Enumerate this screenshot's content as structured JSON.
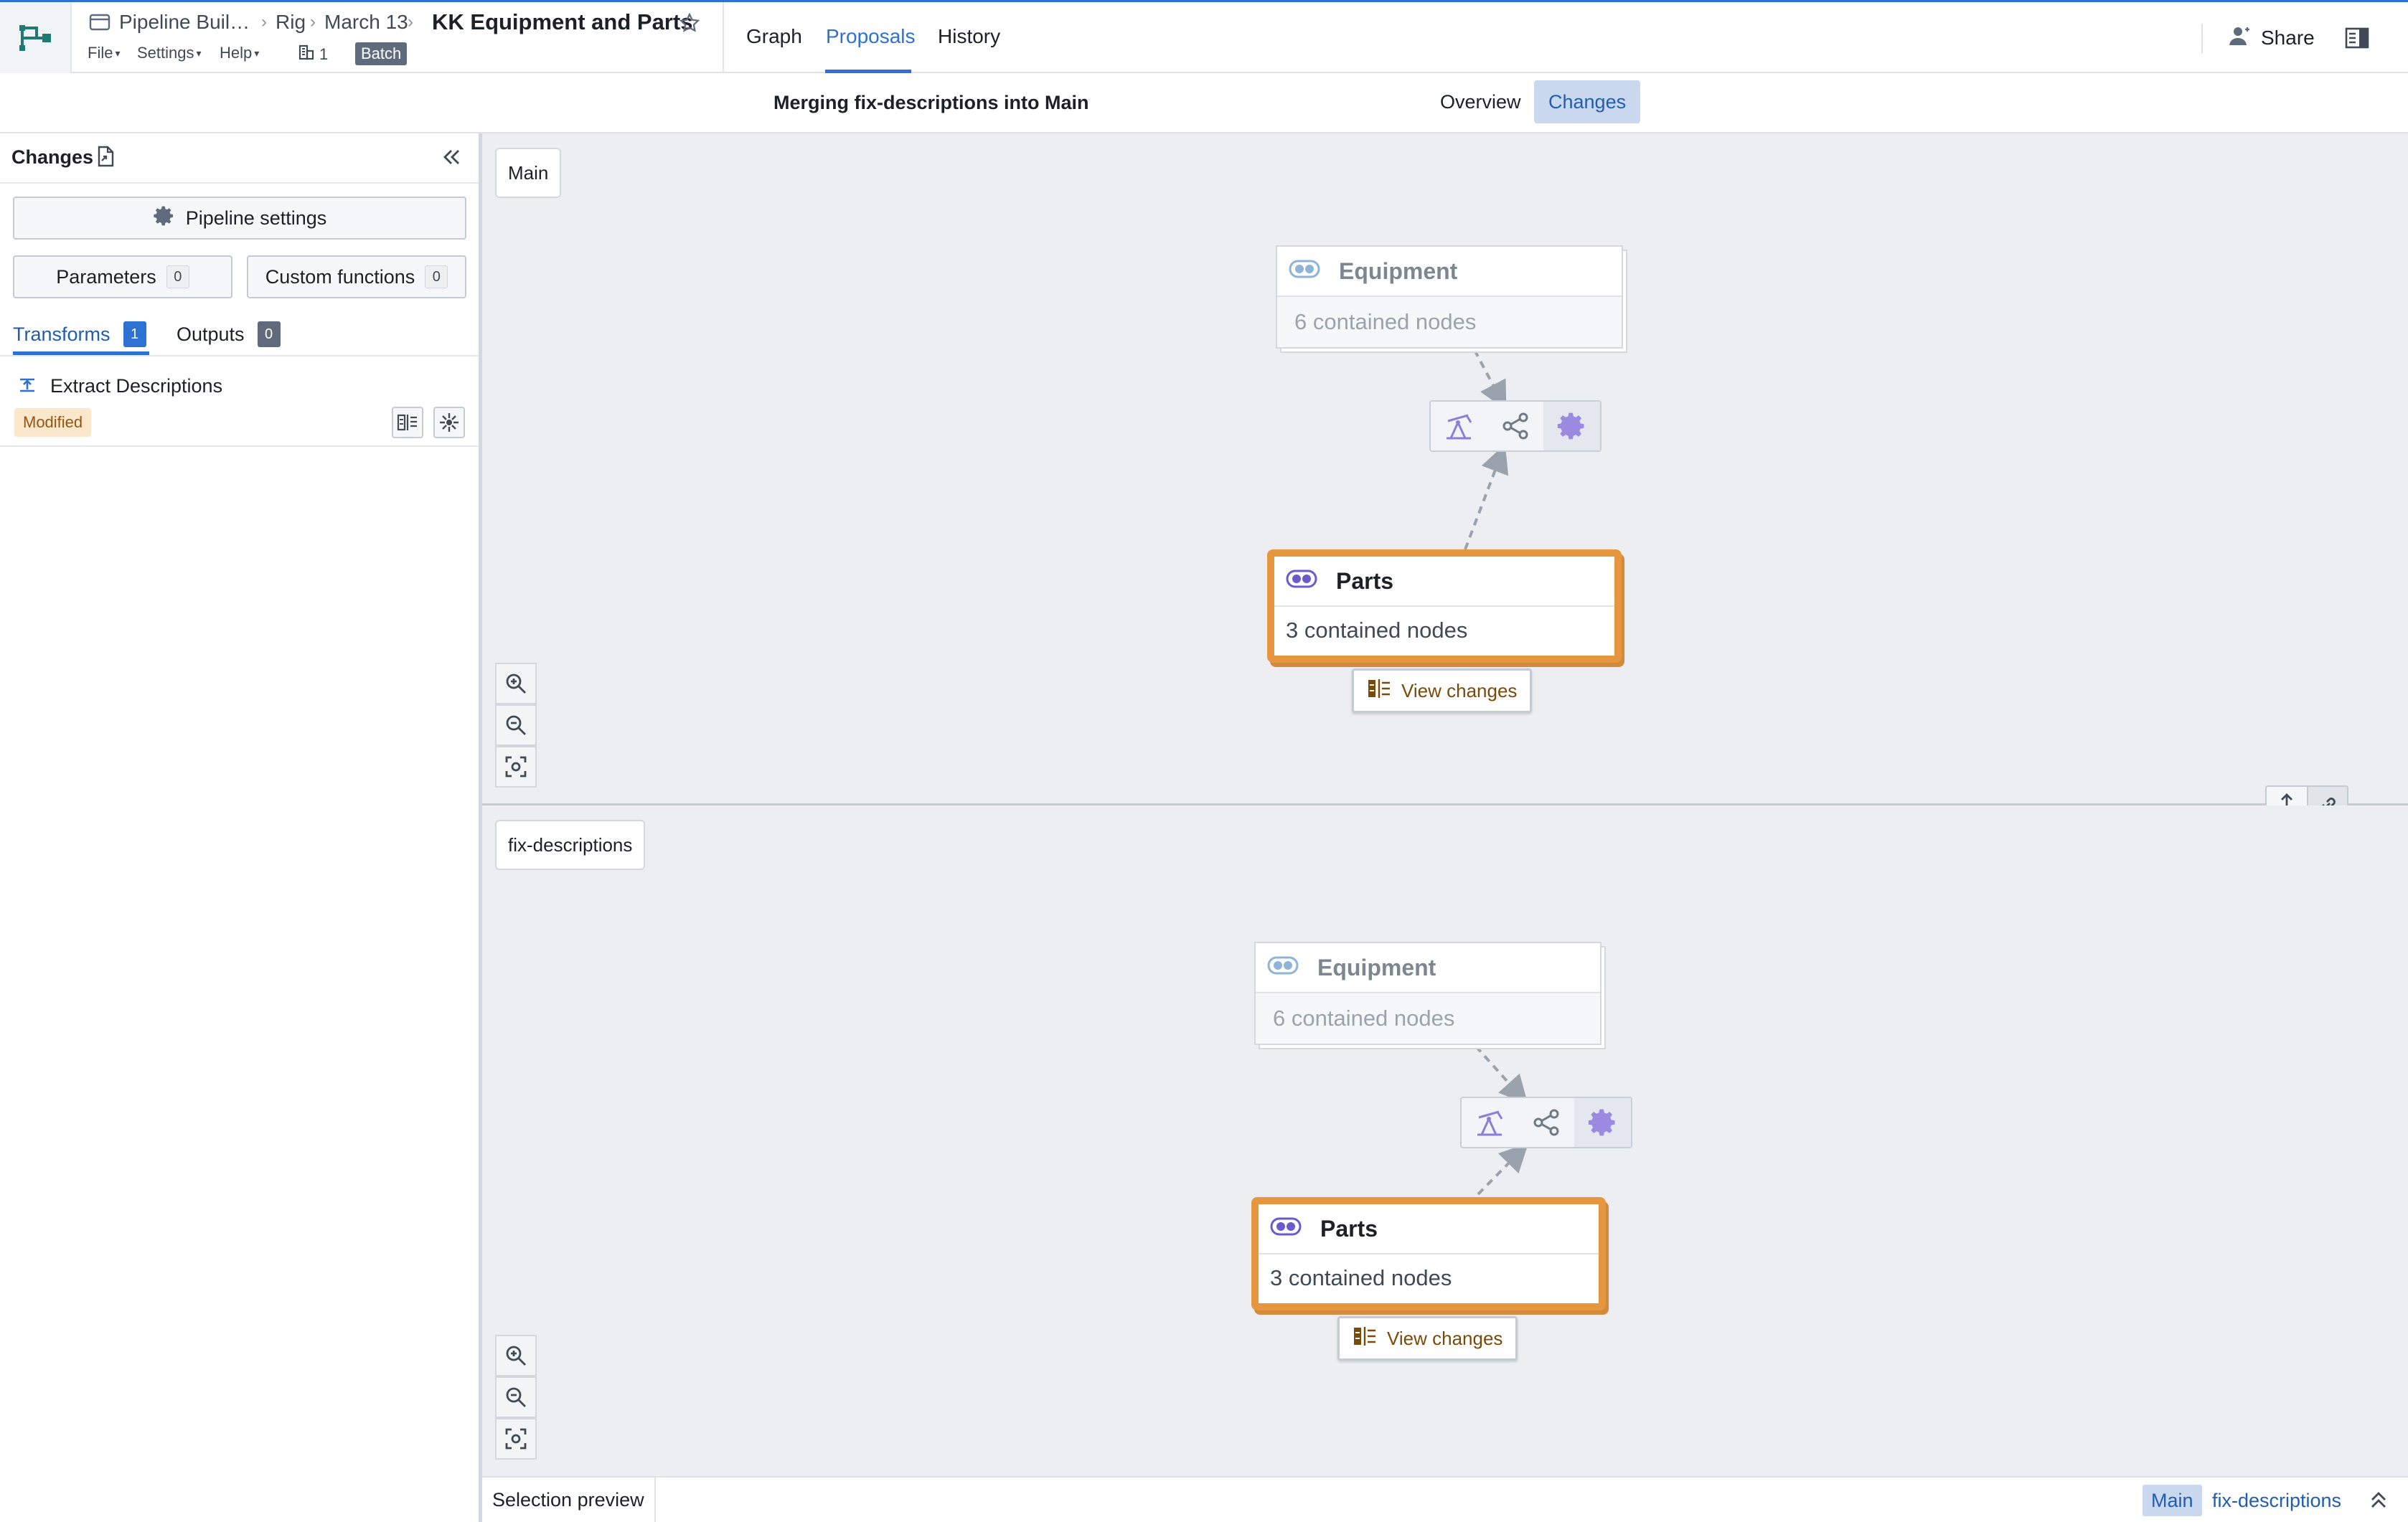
{
  "header": {
    "breadcrumbs": [
      "Pipeline Buil…",
      "Rig",
      "March 13"
    ],
    "title": "KK Equipment and Parts",
    "menus": [
      "File",
      "Settings",
      "Help"
    ],
    "branch_count": "1",
    "mode_badge": "Batch",
    "tabs": [
      "Graph",
      "Proposals",
      "History"
    ],
    "active_tab": "Proposals",
    "share_label": "Share"
  },
  "subheader": {
    "merge_title": "Merging fix-descriptions into Main",
    "tabs": [
      "Overview",
      "Changes"
    ],
    "active_tab": "Changes"
  },
  "left_panel": {
    "title": "Changes",
    "pipeline_settings_label": "Pipeline settings",
    "parameters_label": "Parameters",
    "parameters_count": "0",
    "custom_functions_label": "Custom functions",
    "custom_functions_count": "0",
    "tabs": [
      {
        "label": "Transforms",
        "count": "1"
      },
      {
        "label": "Outputs",
        "count": "0"
      }
    ],
    "active_tab": "Transforms",
    "items": [
      {
        "name": "Extract Descriptions",
        "status": "Modified"
      }
    ]
  },
  "graphs": [
    {
      "branch": "Main",
      "nodes": [
        {
          "title": "Equipment",
          "subtitle": "6 contained nodes",
          "state": "unchanged"
        },
        {
          "title": "Parts",
          "subtitle": "3 contained nodes",
          "state": "modified"
        }
      ],
      "view_changes_label": "View changes"
    },
    {
      "branch": "fix-descriptions",
      "nodes": [
        {
          "title": "Equipment",
          "subtitle": "6 contained nodes",
          "state": "unchanged"
        },
        {
          "title": "Parts",
          "subtitle": "3 contained nodes",
          "state": "modified"
        }
      ],
      "view_changes_label": "View changes"
    }
  ],
  "bottom_bar": {
    "selection_preview_label": "Selection preview",
    "branches": [
      "Main",
      "fix-descriptions"
    ],
    "active_branch": "Main"
  },
  "icons": [
    "pipeline-logo-icon",
    "folder-icon",
    "star-icon",
    "branch-icon",
    "share-user-icon",
    "side-panel-icon",
    "doc-changes-icon",
    "double-chevron-left-icon",
    "gear-icon",
    "transform-icon",
    "diff-icon",
    "graph-locate-icon",
    "zoom-in-icon",
    "zoom-out-icon",
    "fit-view-icon",
    "dataset-group-icon",
    "pump-icon",
    "share-nodes-icon",
    "vertical-resize-icon",
    "link-icon",
    "double-chevron-up-icon"
  ],
  "colors": {
    "accent": "#2d72d2",
    "modified_border": "#e6963f",
    "modified_tag_bg": "#fbe7cc",
    "canvas_bg": "#edeef2",
    "op_icon": "#9b8be0"
  }
}
